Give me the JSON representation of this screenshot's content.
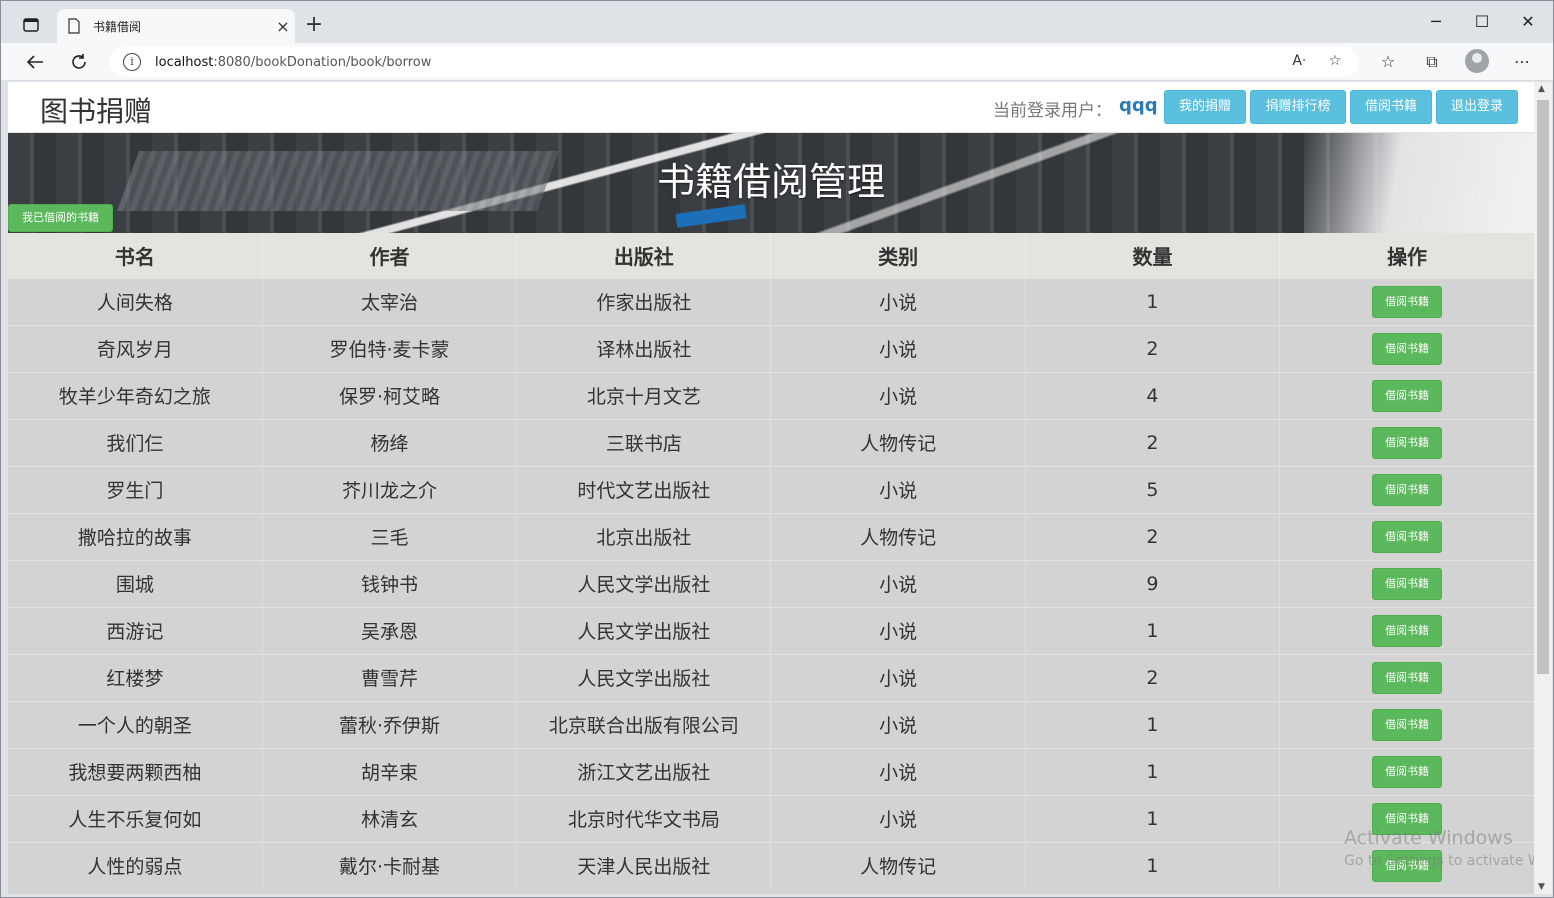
{
  "browser": {
    "tab_title": "书籍借阅",
    "tab_close": "×",
    "new_tab": "+",
    "url_host": "localhost",
    "url_path": ":8080/bookDonation/book/borrow",
    "min": "─",
    "max": "☐",
    "close": "✕"
  },
  "header": {
    "brand": "图书捐赠",
    "login_label": "当前登录用户：",
    "username": "qqq",
    "buttons": [
      "我的捐赠",
      "捐赠排行榜",
      "借阅书籍",
      "退出登录"
    ]
  },
  "banner": {
    "title": "书籍借阅管理",
    "borrowed_button": "我已借阅的书籍"
  },
  "table": {
    "headers": [
      "书名",
      "作者",
      "出版社",
      "类别",
      "数量",
      "操作"
    ],
    "action_label": "借阅书籍",
    "rows": [
      [
        "人间失格",
        "太宰治",
        "作家出版社",
        "小说",
        "1"
      ],
      [
        "奇风岁月",
        "罗伯特·麦卡蒙",
        "译林出版社",
        "小说",
        "2"
      ],
      [
        "牧羊少年奇幻之旅",
        "保罗·柯艾略",
        "北京十月文艺",
        "小说",
        "4"
      ],
      [
        "我们仨",
        "杨绛",
        "三联书店",
        "人物传记",
        "2"
      ],
      [
        "罗生门",
        "芥川龙之介",
        "时代文艺出版社",
        "小说",
        "5"
      ],
      [
        "撒哈拉的故事",
        "三毛",
        "北京出版社",
        "人物传记",
        "2"
      ],
      [
        "围城",
        "钱钟书",
        "人民文学出版社",
        "小说",
        "9"
      ],
      [
        "西游记",
        "吴承恩",
        "人民文学出版社",
        "小说",
        "1"
      ],
      [
        "红楼梦",
        "曹雪芹",
        "人民文学出版社",
        "小说",
        "2"
      ],
      [
        "一个人的朝圣",
        "蕾秋·乔伊斯",
        "北京联合出版有限公司",
        "小说",
        "1"
      ],
      [
        "我想要两颗西柚",
        "胡辛束",
        "浙江文艺出版社",
        "小说",
        "1"
      ],
      [
        "人生不乐复何如",
        "林清玄",
        "北京时代华文书局",
        "小说",
        "1"
      ],
      [
        "人性的弱点",
        "戴尔·卡耐基",
        "天津人民出版社",
        "人物传记",
        "1"
      ]
    ]
  },
  "watermark": {
    "line1": "Activate Windows",
    "line2": "Go to Settings to activate Windows."
  },
  "colors": {
    "info_button": "#5bc0de",
    "success_button": "#5cb85c",
    "username": "#2a7bb8"
  }
}
